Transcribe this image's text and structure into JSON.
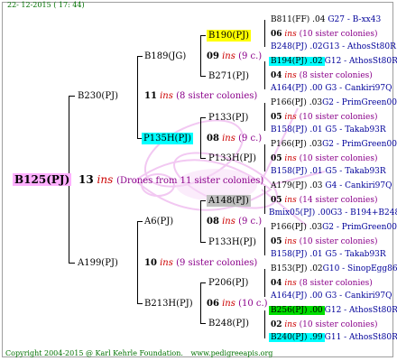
{
  "colors": {
    "background": "#ffffff",
    "frame": "#9e9e9e",
    "root_box": "#ffb0ff",
    "yellow_box": "#ffff00",
    "cyan_box": "#00ffff",
    "gray_box": "#c0c0c0",
    "green_box": "#00dd00",
    "ins_red": "#cc0000",
    "sister_purple": "#8a008a",
    "footer_green": "#007000",
    "link_blue": "#000099"
  },
  "header": {
    "date": "22- 12-2015 ( 17: 44)"
  },
  "footer": {
    "copyright": "Copyright 2004-2015 @ Karl Kehrle Foundation.",
    "site": "www.pedigreeapis.org"
  },
  "root": {
    "name": "B125(PJ)",
    "ins_num": "13",
    "ins": "ins",
    "note": "(Drones from 11 sister colonies)"
  },
  "g1": [
    {
      "name": "B230(PJ)",
      "ins_num": "11",
      "ins": "ins",
      "note": "(8 sister colonies)"
    },
    {
      "name": "A199(PJ)",
      "ins_num": "10",
      "ins": "ins",
      "note": "(9 sister colonies)"
    }
  ],
  "g2": [
    {
      "name": "B189(JG)",
      "ins_num": "09",
      "ins": "ins",
      "note": "(9 c.)"
    },
    {
      "name": "P135H(PJ)",
      "ins_num": "08",
      "ins": "ins",
      "note": "(9 c.)"
    },
    {
      "name": "A6(PJ)",
      "ins_num": "08",
      "ins": "ins",
      "note": "(9 c.)"
    },
    {
      "name": "B213H(PJ)",
      "ins_num": "06",
      "ins": "ins",
      "note": "(10 c.)"
    }
  ],
  "g3": [
    "B190(PJ)",
    "B271(PJ)",
    "P133(PJ)",
    "P133H(PJ)",
    "A148(PJ)",
    "P133H(PJ)",
    "P206(PJ)",
    "B248(PJ)"
  ],
  "g4": [
    {
      "top": "B811(FF) .04",
      "top_b": "G27 - B-xx43",
      "num": "06",
      "ins": "ins",
      "note": "(10 sister colonies)",
      "bot": "B248(PJ) .02G13 - AthosSt80R"
    },
    {
      "top": "B194(PJ) .02",
      "top_b": "G12 - AthosSt80R",
      "num": "04",
      "ins": "ins",
      "note": "(8 sister colonies)",
      "bot": "A164(PJ) .00   G3 - Cankiri97Q"
    },
    {
      "top": "P166(PJ) .03",
      "top_b": "G2 - PrimGreen00",
      "num": "05",
      "ins": "ins",
      "note": "(10 sister colonies)",
      "bot": "B158(PJ) .01     G5 - Takab93R"
    },
    {
      "top": "P166(PJ) .03",
      "top_b": "G2 - PrimGreen00",
      "num": "05",
      "ins": "ins",
      "note": "(10 sister colonies)",
      "bot": "B158(PJ) .01     G5 - Takab93R"
    },
    {
      "top": "A179(PJ) .03",
      "top_b": "G4 - Cankiri97Q",
      "num": "05",
      "ins": "ins",
      "note": "(14 sister colonies)",
      "bot": "Bmix05(PJ) .00G3 - B194+B248+B"
    },
    {
      "top": "P166(PJ) .03",
      "top_b": "G2 - PrimGreen00",
      "num": "05",
      "ins": "ins",
      "note": "(10 sister colonies)",
      "bot": "B158(PJ) .01     G5 - Takab93R"
    },
    {
      "top": "B153(PJ) .02",
      "top_b": "G10 - SinopEgg86R",
      "num": "04",
      "ins": "ins",
      "note": "(8 sister colonies)",
      "bot": "A164(PJ) .00   G3 - Cankiri97Q"
    },
    {
      "top": "B256(PJ) .00",
      "top_b": "G12 - AthosSt80R",
      "num": "02",
      "ins": "ins",
      "note": "(10 sister colonies)",
      "bot": "B240(PJ) .99",
      "bot_b": "G11 - AthosSt80R"
    }
  ]
}
